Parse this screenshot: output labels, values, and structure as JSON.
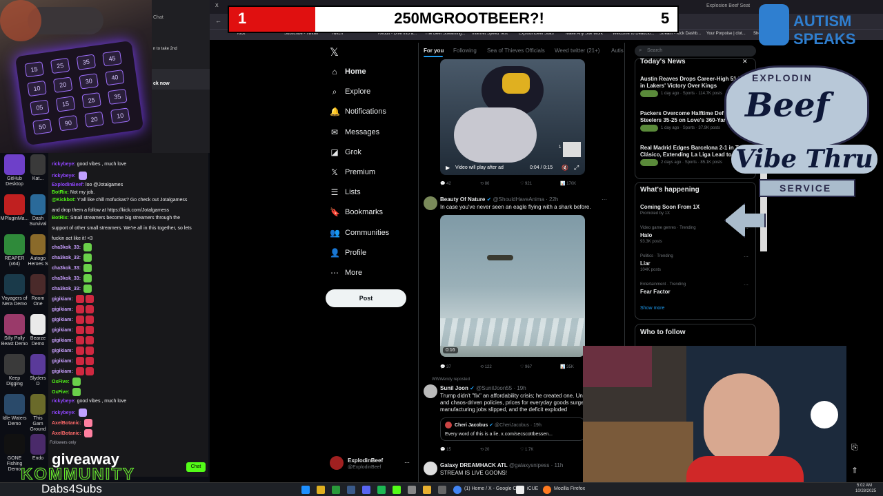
{
  "scoreboard": {
    "left_score": "1",
    "title": "250MGROOTBEER?!",
    "right_score": "5"
  },
  "overlays": {
    "autism_line1": "AUTISM",
    "autism_line2": "SPEAKS",
    "beef_top": "EXPLODIN",
    "beef_main": "Beef",
    "beef_sub": "Vibe Thru",
    "beef_service": "SERVICE",
    "giveaway": "giveaway",
    "kommunity": "KOMMUNITY",
    "dabs": "Dabs4Subs"
  },
  "browser": {
    "tabs": [
      "X",
      "Watch Reel Magic",
      "Bored Beef",
      "Mrs Theme Foot",
      "Is Game",
      "Stat R",
      "Explosion Beef Seat"
    ],
    "bookmarks": [
      "Kick",
      "Subscribe - Twitter",
      "Twitch",
      "Reddit - Dive into a...",
      "The Beef Streaming...",
      "Internet Speed Test",
      "ExplodinBeef Stats",
      "Make Any Site Work",
      "Welcome to Deadclo...",
      "Stream - Kick Dashb...",
      "Your Porpoise | clot...",
      "Shedo"
    ]
  },
  "chat": {
    "top_text_1": "Chat",
    "top_text_2": "n to take 2nd",
    "top_text_3": "ck now",
    "lines": [
      {
        "name": "rickybeye:",
        "text": "good vibes , much love",
        "color": "#9146ff"
      },
      {
        "name": "rickybeye:",
        "text": "",
        "color": "#9146ff"
      },
      {
        "name": "ExplodinBeef:",
        "text": "loo @Jotalgames",
        "color": "#9146ff"
      },
      {
        "name": "BotRix:",
        "text": "Not my job.",
        "color": "#53fc18"
      },
      {
        "name": "@Kickbot:",
        "text": "Y'all like chill mofuckas? Go check out Jotalgamess",
        "color": "#53fc18"
      },
      {
        "name": "",
        "text": "and drop them a follow at https://kick.com/Jotalgamess",
        "color": "#efeff1"
      },
      {
        "name": "BotRix:",
        "text": "Small streamers become big streamers through the",
        "color": "#53fc18"
      },
      {
        "name": "",
        "text": "support of other small streamers. We're all in this together, so lets",
        "color": "#efeff1"
      },
      {
        "name": "",
        "text": "fuckin act like it! <3",
        "color": "#efeff1"
      },
      {
        "name": "cha3kok_33:",
        "text": "",
        "color": "#c9a0ff"
      },
      {
        "name": "cha3kok_33:",
        "text": "",
        "color": "#c9a0ff"
      },
      {
        "name": "cha3kok_33:",
        "text": "",
        "color": "#c9a0ff"
      },
      {
        "name": "cha3kok_33:",
        "text": "",
        "color": "#c9a0ff"
      },
      {
        "name": "cha3kok_33:",
        "text": "",
        "color": "#c9a0ff"
      },
      {
        "name": "gigikiam:",
        "text": "",
        "color": "#c9a0ff"
      },
      {
        "name": "gigikiam:",
        "text": "",
        "color": "#c9a0ff"
      },
      {
        "name": "gigikiam:",
        "text": "",
        "color": "#c9a0ff"
      },
      {
        "name": "gigikiam:",
        "text": "",
        "color": "#c9a0ff"
      },
      {
        "name": "gigikiam:",
        "text": "",
        "color": "#c9a0ff"
      },
      {
        "name": "gigikiam:",
        "text": "",
        "color": "#c9a0ff"
      },
      {
        "name": "gigikiam:",
        "text": "",
        "color": "#c9a0ff"
      },
      {
        "name": "gigikiam:",
        "text": "",
        "color": "#c9a0ff"
      },
      {
        "name": "OxFive:",
        "text": "",
        "color": "#53fc18"
      },
      {
        "name": "OxFive:",
        "text": "",
        "color": "#53fc18"
      },
      {
        "name": "rickybeye:",
        "text": "good vibes , much love",
        "color": "#9146ff"
      },
      {
        "name": "rickybeye:",
        "text": "",
        "color": "#9146ff"
      },
      {
        "name": "AxelBotanic:",
        "text": "",
        "color": "#ff6a6a"
      },
      {
        "name": "AxelBotanic:",
        "text": "",
        "color": "#ff6a6a"
      }
    ],
    "followers_only": "Followers only",
    "chat_button": "Chat"
  },
  "desktop_icons": [
    {
      "label": "GitHub Desktop",
      "color": "#6e40c9"
    },
    {
      "label": "Kat...",
      "color": "#3a3a3a"
    },
    {
      "label": "MPluginMa...",
      "color": "#c02020"
    },
    {
      "label": "Dash Survival",
      "color": "#2a6a9a"
    },
    {
      "label": "REAPER (x64)",
      "color": "#2f8a3a"
    },
    {
      "label": "Autogo Heroes S",
      "color": "#8a6a2a"
    },
    {
      "label": "Voyagers of Nera Demo",
      "color": "#1a3a4a"
    },
    {
      "label": "Room One",
      "color": "#4a2a2a"
    },
    {
      "label": "Silly Polly Beast Demo",
      "color": "#9a3a6a"
    },
    {
      "label": "Bearze Demo",
      "color": "#eaeaea"
    },
    {
      "label": "Keep Digging",
      "color": "#3a3a3a"
    },
    {
      "label": "Slyders D",
      "color": "#5a3a9a"
    },
    {
      "label": "Idle Waters Demo",
      "color": "#2a4a6a"
    },
    {
      "label": "This Gam Ground",
      "color": "#6a6a2a"
    },
    {
      "label": "GONE Fishing Demo",
      "color": "#111"
    },
    {
      "label": "Endo",
      "color": "#4a2a6a"
    }
  ],
  "x_sidebar": {
    "logo": "𝕏",
    "items": [
      {
        "label": "Home",
        "icon": "⌂",
        "bold": true
      },
      {
        "label": "Explore",
        "icon": "⌕"
      },
      {
        "label": "Notifications",
        "icon": "🔔"
      },
      {
        "label": "Messages",
        "icon": "✉"
      },
      {
        "label": "Grok",
        "icon": "◪"
      },
      {
        "label": "Premium",
        "icon": "𝕏"
      },
      {
        "label": "Lists",
        "icon": "☰"
      },
      {
        "label": "Bookmarks",
        "icon": "🔖"
      },
      {
        "label": "Communities",
        "icon": "👥"
      },
      {
        "label": "Profile",
        "icon": "👤"
      },
      {
        "label": "More",
        "icon": "⋯"
      }
    ],
    "post_button": "Post",
    "account_name": "ExplodinBeef",
    "account_handle": "@ExplodinBeef"
  },
  "feed": {
    "tabs": [
      "For you",
      "Following",
      "Sea of Thieves Officials",
      "Weed twitter (21+)",
      "Autis"
    ],
    "video1": {
      "overlay": "Video will play after ad",
      "time": "0:04 / 0:15",
      "count": "1"
    },
    "video1_actions": [
      "42",
      "86",
      "921",
      "170K"
    ],
    "tweet2": {
      "name": "Beauty Of Nature",
      "handle": "@ShouldHaveAnima · 22h",
      "text": "In case you've never seen an eagle flying with a shark before.",
      "duration": "0:16"
    },
    "tweet2_actions": [
      "37",
      "122",
      "967",
      "35K"
    ],
    "tweet3": {
      "repost": "WWWendy reposted",
      "name": "Sunil Joon",
      "handle": "@SunilJoon55 · 19h",
      "lines": [
        "Trump didn't \"fix\" an affordability crisis; he created one. Unr",
        "and chaos-driven policies, prices for everyday goods surged",
        "manufacturing jobs slipped, and the deficit exploded"
      ],
      "quote_name": "Cheri Jacobus",
      "quote_handle": "@CheriJacobus · 19h",
      "quote_text": "Every word of this is a lie. x.com/secscottbessen..."
    },
    "tweet3_actions": [
      "15",
      "20",
      "1.7K"
    ],
    "tweet4": {
      "name": "Galaxy",
      "extra": "DREAMHACK ATL",
      "handle": "@galaxysnipess · 11h",
      "text": "STREAM IS LIVE GOONS!"
    }
  },
  "right_col": {
    "search_placeholder": "Search",
    "news_title": "Today's News",
    "news": [
      {
        "headline": "Austin Reaves Drops Career-High 51 Po",
        "line2": "in Lakers' Victory Over Kings",
        "meta": "1 day ago · Sports · 114.7K posts"
      },
      {
        "headline": "Packers Overcome Halftime Def",
        "line2": "Steelers 35-25 on Love's 360-Yar",
        "meta": "1 day ago · Sports · 37.9K posts"
      },
      {
        "headline": "Real Madrid Edges Barcelona 2-1 in Te",
        "line2": "Clásico, Extending La Liga Lead to Five",
        "meta": "2 days ago · Sports · 85.1K posts"
      }
    ],
    "happening_title": "What's happening",
    "trends": [
      {
        "label": "Coming Soon From 1X",
        "meta": "Promoted by 1X",
        "cat": ""
      },
      {
        "cat": "Video game genres · Trending",
        "label": "Halo",
        "meta": "93.3K posts"
      },
      {
        "cat": "Politics · Trending",
        "label": "Liar",
        "meta": "104K posts"
      },
      {
        "cat": "Entertainment · Trending",
        "label": "Fear Factor",
        "meta": ""
      }
    ],
    "show_more": "Show more",
    "who_to_follow": "Who to follow"
  },
  "taskbar": {
    "apps": [
      "(1) Home / X - Google C",
      "iCUE",
      "Mozilla Firefox"
    ],
    "time": "5:02 AM",
    "date": "10/28/2025"
  }
}
